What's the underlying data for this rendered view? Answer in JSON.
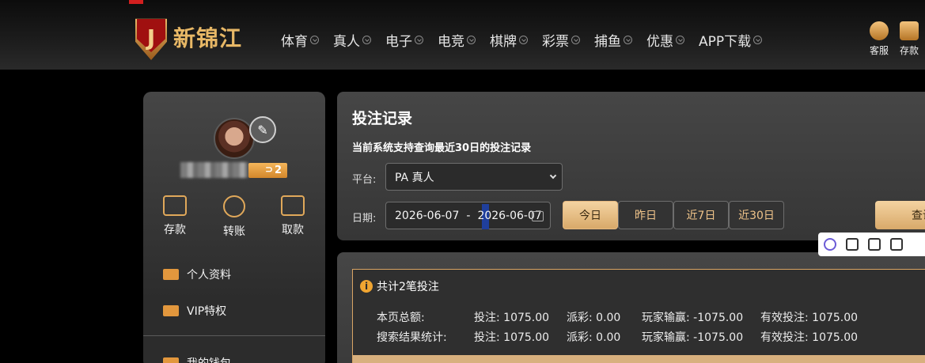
{
  "header": {
    "logo_text": "新锦江",
    "logo_letter": "J",
    "nav": [
      "体育",
      "真人",
      "电子",
      "电竞",
      "棋牌",
      "彩票",
      "捕鱼",
      "优惠",
      "APP下载"
    ],
    "right": [
      {
        "label": "客服",
        "icon": "customer-service-icon"
      },
      {
        "label": "存款",
        "icon": "wallet-icon"
      }
    ]
  },
  "sidebar": {
    "vip_level": "2",
    "actions": [
      {
        "label": "存款",
        "icon": "deposit-icon"
      },
      {
        "label": "转账",
        "icon": "transfer-icon"
      },
      {
        "label": "取款",
        "icon": "withdraw-icon"
      }
    ],
    "menu": [
      {
        "label": "个人资料",
        "icon": "profile-icon"
      },
      {
        "label": "VIP特权",
        "icon": "vip-icon"
      },
      {
        "label": "我的钱包",
        "icon": "wallet-icon"
      }
    ]
  },
  "records": {
    "title": "投注记录",
    "subtitle": "当前系统支持查询最近30日的投注记录",
    "platform_label": "平台:",
    "platform_value": "PA 真人",
    "date_label": "日期:",
    "date_start": "2026-06-07",
    "date_sep": "-",
    "date_end": "2026-06-07",
    "ranges": [
      "今日",
      "昨日",
      "近7日",
      "近30日"
    ],
    "active_range": "今日",
    "query_label": "查询"
  },
  "summary": {
    "header": "共计2笔投注",
    "rows": [
      {
        "label": "本页总额:",
        "bet": "投注: 1075.00",
        "payout": "派彩: 0.00",
        "player_win": "玩家输赢: -1075.00",
        "valid_bet": "有效投注: 1075.00"
      },
      {
        "label": "搜索结果统计:",
        "bet": "投注: 1075.00",
        "payout": "派彩: 0.00",
        "player_win": "玩家输赢: -1075.00",
        "valid_bet": "有效投注: 1075.00"
      }
    ]
  },
  "colors": {
    "accent_gold": "#e0a85a",
    "button_gold": "#d8a96a",
    "panel_bg": "#464646"
  }
}
